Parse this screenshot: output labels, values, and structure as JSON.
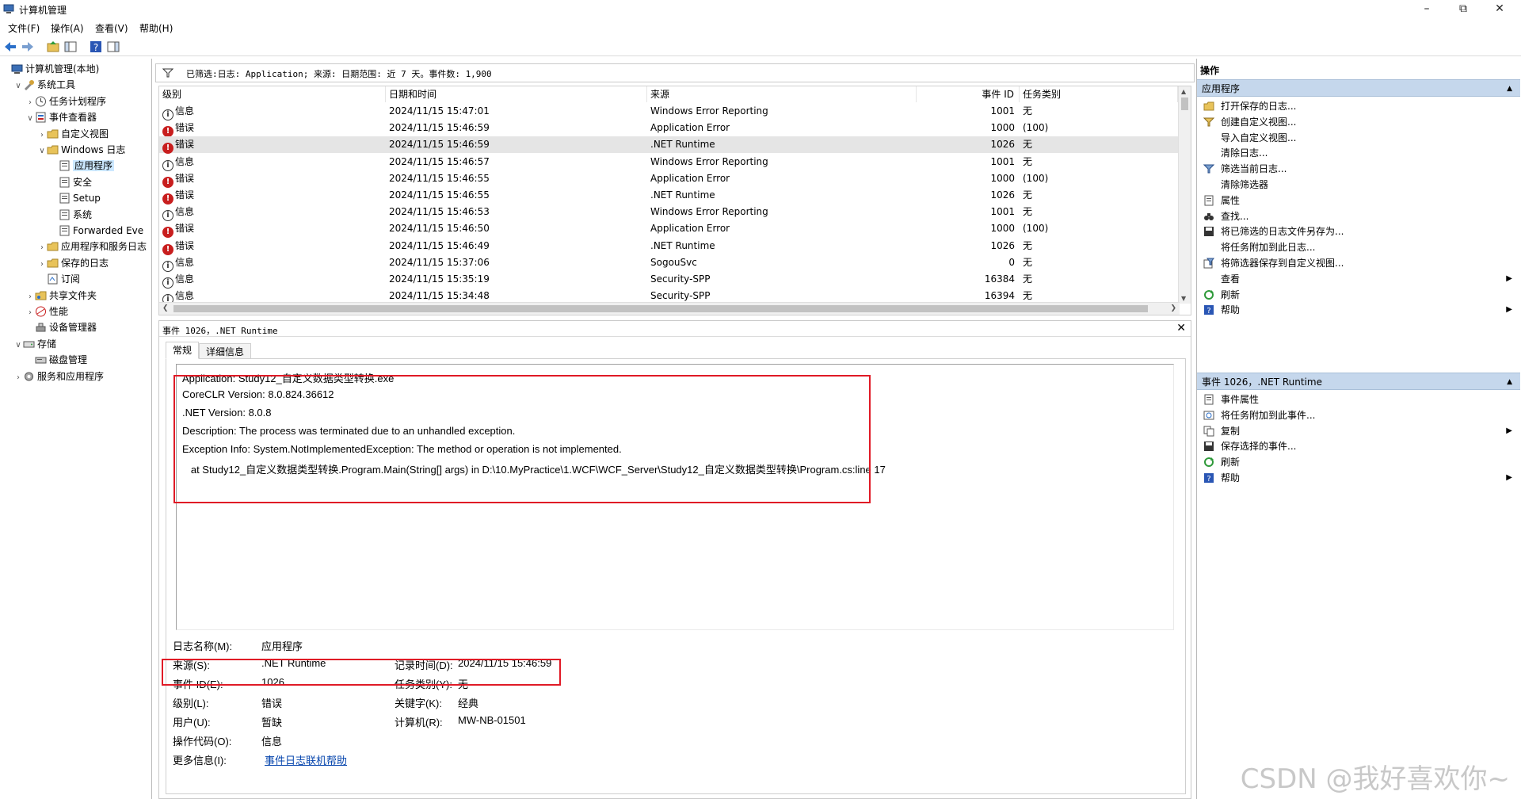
{
  "window": {
    "title": "计算机管理"
  },
  "menu": [
    "文件(F)",
    "操作(A)",
    "查看(V)",
    "帮助(H)"
  ],
  "tree": [
    {
      "label": "计算机管理(本地)",
      "indent": 0,
      "chev": "",
      "icon": "computer-icon"
    },
    {
      "label": "系统工具",
      "indent": 1,
      "chev": "v",
      "icon": "tools-icon"
    },
    {
      "label": "任务计划程序",
      "indent": 2,
      "chev": ">",
      "icon": "clock-icon"
    },
    {
      "label": "事件查看器",
      "indent": 2,
      "chev": "v",
      "icon": "event-viewer-icon"
    },
    {
      "label": "自定义视图",
      "indent": 3,
      "chev": ">",
      "icon": "folder-icon"
    },
    {
      "label": "Windows 日志",
      "indent": 3,
      "chev": "v",
      "icon": "folder-icon"
    },
    {
      "label": "应用程序",
      "indent": 4,
      "chev": "",
      "icon": "log-icon",
      "selected": true
    },
    {
      "label": "安全",
      "indent": 4,
      "chev": "",
      "icon": "log-icon"
    },
    {
      "label": "Setup",
      "indent": 4,
      "chev": "",
      "icon": "log-icon"
    },
    {
      "label": "系统",
      "indent": 4,
      "chev": "",
      "icon": "log-icon"
    },
    {
      "label": "Forwarded Eve",
      "indent": 4,
      "chev": "",
      "icon": "log-icon"
    },
    {
      "label": "应用程序和服务日志",
      "indent": 3,
      "chev": ">",
      "icon": "folder-icon"
    },
    {
      "label": "保存的日志",
      "indent": 3,
      "chev": ">",
      "icon": "folder-icon"
    },
    {
      "label": "订阅",
      "indent": 3,
      "chev": "",
      "icon": "subscription-icon"
    },
    {
      "label": "共享文件夹",
      "indent": 2,
      "chev": ">",
      "icon": "shared-folder-icon"
    },
    {
      "label": "性能",
      "indent": 2,
      "chev": ">",
      "icon": "performance-icon"
    },
    {
      "label": "设备管理器",
      "indent": 2,
      "chev": "",
      "icon": "device-manager-icon"
    },
    {
      "label": "存储",
      "indent": 1,
      "chev": "v",
      "icon": "storage-icon"
    },
    {
      "label": "磁盘管理",
      "indent": 2,
      "chev": "",
      "icon": "disk-icon"
    },
    {
      "label": "服务和应用程序",
      "indent": 1,
      "chev": ">",
      "icon": "services-icon"
    }
  ],
  "filter": {
    "text": "已筛选:日志: Application; 来源: 日期范围: 近 7 天。事件数: 1,900"
  },
  "grid": {
    "columns": [
      "级别",
      "日期和时间",
      "来源",
      "事件 ID",
      "任务类别"
    ],
    "rows": [
      {
        "level": "信息",
        "type": "info",
        "datetime": "2024/11/15 15:47:01",
        "source": "Windows Error Reporting",
        "id": "1001",
        "task": "无"
      },
      {
        "level": "错误",
        "type": "error",
        "datetime": "2024/11/15 15:46:59",
        "source": "Application Error",
        "id": "1000",
        "task": "(100)"
      },
      {
        "level": "错误",
        "type": "error",
        "datetime": "2024/11/15 15:46:59",
        "source": ".NET Runtime",
        "id": "1026",
        "task": "无",
        "selected": true
      },
      {
        "level": "信息",
        "type": "info",
        "datetime": "2024/11/15 15:46:57",
        "source": "Windows Error Reporting",
        "id": "1001",
        "task": "无"
      },
      {
        "level": "错误",
        "type": "error",
        "datetime": "2024/11/15 15:46:55",
        "source": "Application Error",
        "id": "1000",
        "task": "(100)"
      },
      {
        "level": "错误",
        "type": "error",
        "datetime": "2024/11/15 15:46:55",
        "source": ".NET Runtime",
        "id": "1026",
        "task": "无"
      },
      {
        "level": "信息",
        "type": "info",
        "datetime": "2024/11/15 15:46:53",
        "source": "Windows Error Reporting",
        "id": "1001",
        "task": "无"
      },
      {
        "level": "错误",
        "type": "error",
        "datetime": "2024/11/15 15:46:50",
        "source": "Application Error",
        "id": "1000",
        "task": "(100)"
      },
      {
        "level": "错误",
        "type": "error",
        "datetime": "2024/11/15 15:46:49",
        "source": ".NET Runtime",
        "id": "1026",
        "task": "无"
      },
      {
        "level": "信息",
        "type": "info",
        "datetime": "2024/11/15 15:37:06",
        "source": "SogouSvc",
        "id": "0",
        "task": "无"
      },
      {
        "level": "信息",
        "type": "info",
        "datetime": "2024/11/15 15:35:19",
        "source": "Security-SPP",
        "id": "16384",
        "task": "无"
      },
      {
        "level": "信息",
        "type": "info",
        "datetime": "2024/11/15 15:34:48",
        "source": "Security-SPP",
        "id": "16394",
        "task": "无"
      }
    ]
  },
  "detail": {
    "title": "事件 1026，.NET Runtime",
    "tabs": [
      "常规",
      "详细信息"
    ],
    "description": [
      "Application: Study12_自定义数据类型转换.exe",
      "CoreCLR Version: 8.0.824.36612",
      ".NET Version: 8.0.8",
      "Description: The process was terminated due to an unhandled exception.",
      "Exception Info: System.NotImplementedException: The method or operation is not implemented.",
      "   at Study12_自定义数据类型转换.Program.Main(String[] args) in D:\\10.MyPractice\\1.WCF\\WCF_Server\\Study12_自定义数据类型转换\\Program.cs:line 17"
    ],
    "props": {
      "log_name_label": "日志名称(M):",
      "log_name": "应用程序",
      "source_label": "来源(S):",
      "source": ".NET Runtime",
      "logged_label": "记录时间(D):",
      "logged": "2024/11/15 15:46:59",
      "event_id_label": "事件 ID(E):",
      "event_id": "1026",
      "task_label": "任务类别(Y):",
      "task": "无",
      "level_label": "级别(L):",
      "level": "错误",
      "keywords_label": "关键字(K):",
      "keywords": "经典",
      "user_label": "用户(U):",
      "user": "暂缺",
      "computer_label": "计算机(R):",
      "computer": "MW-NB-01501",
      "opcode_label": "操作代码(O):",
      "opcode": "信息",
      "more_label": "更多信息(I):",
      "more_link": "事件日志联机帮助"
    }
  },
  "actions": {
    "title": "操作",
    "section1": {
      "header": "应用程序",
      "items": [
        {
          "label": "打开保存的日志...",
          "icon": "open-folder-icon"
        },
        {
          "label": "创建自定义视图...",
          "icon": "create-filter-icon"
        },
        {
          "label": "导入自定义视图...",
          "icon": ""
        },
        {
          "label": "清除日志...",
          "icon": ""
        },
        {
          "label": "筛选当前日志...",
          "icon": "filter-icon"
        },
        {
          "label": "清除筛选器",
          "icon": ""
        },
        {
          "label": "属性",
          "icon": "properties-icon"
        },
        {
          "label": "查找...",
          "icon": "binoculars-icon"
        },
        {
          "label": "将已筛选的日志文件另存为...",
          "icon": "save-icon"
        },
        {
          "label": "将任务附加到此日志...",
          "icon": ""
        },
        {
          "label": "将筛选器保存到自定义视图...",
          "icon": "save-filter-icon"
        },
        {
          "label": "查看",
          "icon": "",
          "submenu": true
        },
        {
          "label": "刷新",
          "icon": "refresh-icon"
        },
        {
          "label": "帮助",
          "icon": "help-icon",
          "submenu": true
        }
      ]
    },
    "section2": {
      "header": "事件 1026，.NET Runtime",
      "items": [
        {
          "label": "事件属性",
          "icon": "properties-icon"
        },
        {
          "label": "将任务附加到此事件...",
          "icon": "task-icon"
        },
        {
          "label": "复制",
          "icon": "copy-icon",
          "submenu": true
        },
        {
          "label": "保存选择的事件...",
          "icon": "save-icon"
        },
        {
          "label": "刷新",
          "icon": "refresh-icon"
        },
        {
          "label": "帮助",
          "icon": "help-icon",
          "submenu": true
        }
      ]
    }
  },
  "watermark": "CSDN @我好喜欢你~"
}
